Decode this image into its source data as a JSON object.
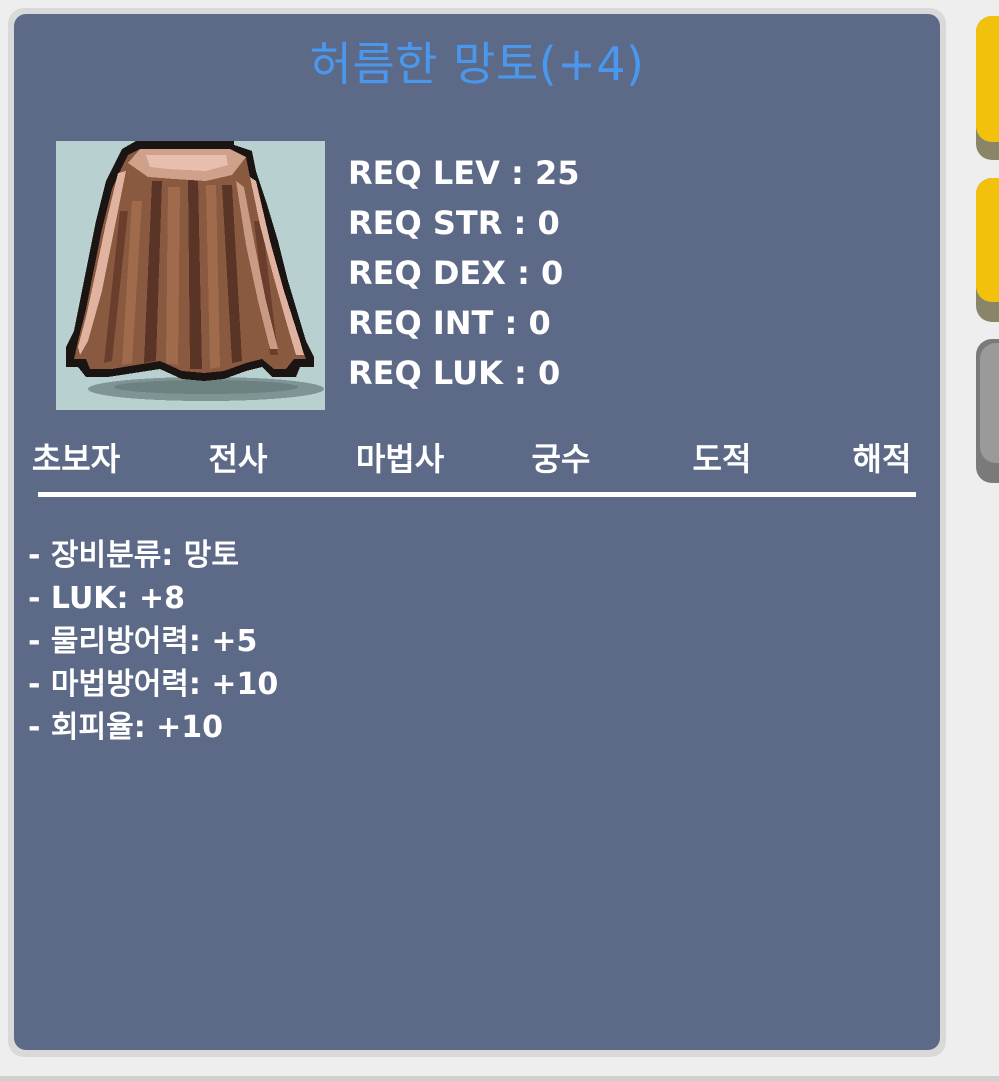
{
  "item": {
    "name": "허름한 망토(+4)",
    "title_color": "#4a98ee",
    "icon": "cape-icon",
    "requirements": [
      "REQ LEV : 25",
      "REQ STR : 0",
      "REQ DEX : 0",
      "REQ INT : 0",
      "REQ LUK : 0"
    ],
    "jobs": [
      "초보자",
      "전사",
      "마법사",
      "궁수",
      "도적",
      "해적"
    ],
    "stats": [
      "- 장비분류: 망토",
      "- LUK: +8",
      "- 물리방어력: +5",
      "- 마법방어력: +10",
      "- 회피율: +10"
    ]
  },
  "side_buttons": [
    {
      "color": "#f2c10c"
    },
    {
      "color": "#f2c10c"
    },
    {
      "color": "#9a9a9a"
    }
  ]
}
